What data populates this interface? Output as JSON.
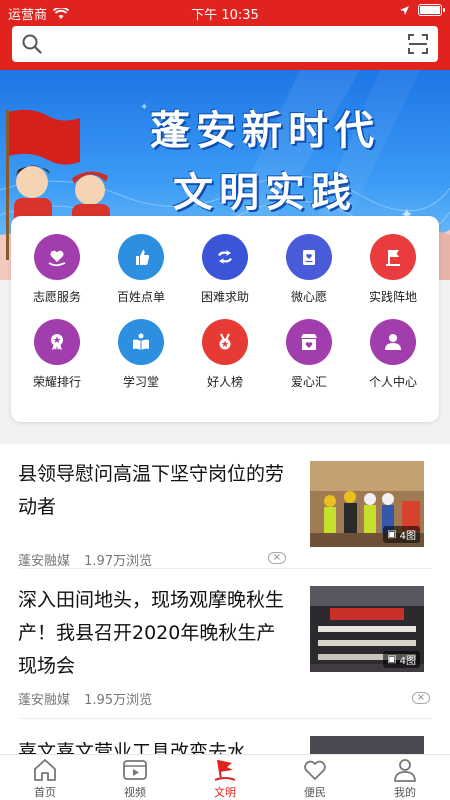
{
  "status": {
    "carrier": "运营商",
    "time": "下午 10:35"
  },
  "search": {
    "placeholder": ""
  },
  "banner": {
    "line1": "蓬安新时代",
    "line2": "文明实践"
  },
  "menu": [
    {
      "label": "志愿服务",
      "icon": "heart-hand-icon",
      "color": "#a23dae"
    },
    {
      "label": "百姓点单",
      "icon": "thumbs-up-icon",
      "color": "#2c8fe0"
    },
    {
      "label": "困难求助",
      "icon": "help-exchange-icon",
      "color": "#3a55d8"
    },
    {
      "label": "微心愿",
      "icon": "wish-card-icon",
      "color": "#4a5bd9"
    },
    {
      "label": "实践阵地",
      "icon": "flag-icon",
      "color": "#ea3b3e"
    },
    {
      "label": "荣耀排行",
      "icon": "medal-icon",
      "color": "#a23dae"
    },
    {
      "label": "学习堂",
      "icon": "book-reader-icon",
      "color": "#2c8fe0"
    },
    {
      "label": "好人榜",
      "icon": "award-icon",
      "color": "#e83a35"
    },
    {
      "label": "爱心汇",
      "icon": "store-heart-icon",
      "color": "#a23dae"
    },
    {
      "label": "个人中心",
      "icon": "user-icon",
      "color": "#a23dae"
    }
  ],
  "news": [
    {
      "title": "县领导慰问高温下坚守岗位的劳动者",
      "source": "蓬安融媒",
      "views": "1.97万浏览",
      "photos": "4图"
    },
    {
      "title": "深入田间地头，现场观摩晚秋生产！我县召开2020年晚秋生产现场会",
      "source": "蓬安融媒",
      "views": "1.95万浏览",
      "photos": "4图"
    },
    {
      "title": "喜文喜文营业工具改变去水"
    }
  ],
  "tabs": [
    {
      "label": "首页",
      "icon": "home-icon"
    },
    {
      "label": "视频",
      "icon": "video-icon"
    },
    {
      "label": "文明",
      "icon": "civilization-flag-icon",
      "active": true
    },
    {
      "label": "便民",
      "icon": "heart-outline-icon"
    },
    {
      "label": "我的",
      "icon": "profile-icon"
    }
  ],
  "colors": {
    "brand": "#e0231f",
    "banner": "#1d76e6"
  }
}
